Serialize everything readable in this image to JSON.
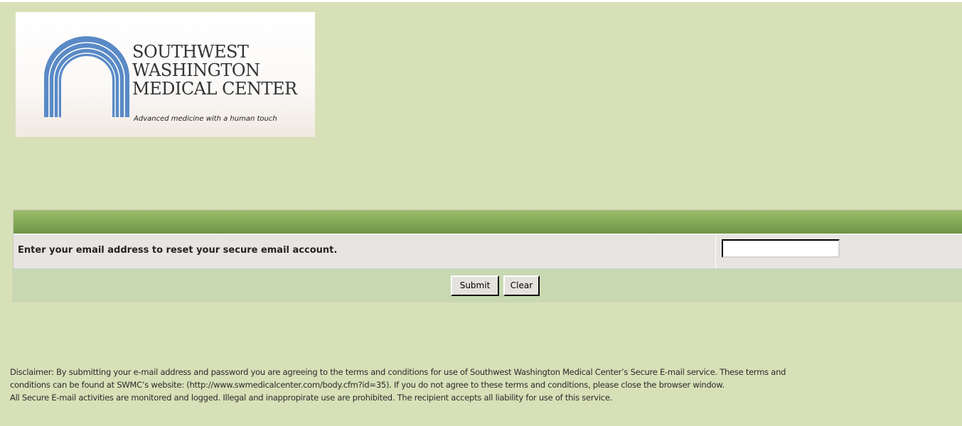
{
  "logo": {
    "line1": "SOUTHWEST",
    "line2": "WASHINGTON",
    "line3": "MEDICAL CENTER",
    "tagline": "Advanced medicine with a human touch",
    "arch_color": "#5a8ac6",
    "icon": "arches-icon"
  },
  "form": {
    "header_color": "#82a856",
    "label": "Enter your email address to reset your secure email account.",
    "email_value": "",
    "submit_label": "Submit",
    "clear_label": "Clear"
  },
  "disclaimer": {
    "line1": "Disclaimer: By submitting your e-mail address and password you are agreeing to the terms and conditions for use of Southwest Washington Medical Center’s Secure E-mail service. These terms and",
    "line2": "conditions can be found at SWMC’s website: (http://www.swmedicalcenter.com/body.cfm?id=35). If you do not agree to these terms and conditions, please close the browser window.",
    "line3": "All Secure E-mail activities are monitored and logged. Illegal and inappropirate use are prohibited. The recipient accepts all liability for use of this service."
  },
  "colors": {
    "page_background": "#d8e0b8",
    "row_background": "#e8e4e2",
    "buttons_row_background": "#c8d9b2"
  }
}
